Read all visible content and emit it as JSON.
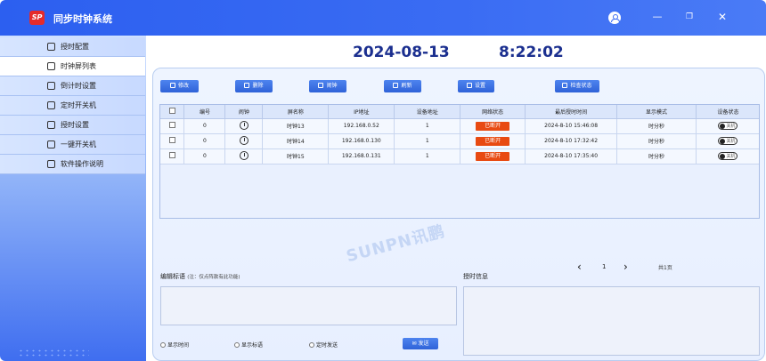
{
  "app": {
    "title": "同步时钟系统",
    "logo_text": "SP"
  },
  "window_controls": [
    "minimize-icon",
    "restore-icon",
    "close-icon"
  ],
  "sidebar": {
    "items": [
      {
        "label": "授时配置",
        "icon": "clock-sync-icon"
      },
      {
        "label": "时钟屏列表",
        "icon": "list-icon",
        "active": true
      },
      {
        "label": "倒计时设置",
        "icon": "hourglass-icon"
      },
      {
        "label": "定时开关机",
        "icon": "power-timer-icon"
      },
      {
        "label": "授时设置",
        "icon": "clock-settings-icon"
      },
      {
        "label": "一键开关机",
        "icon": "power-icon"
      },
      {
        "label": "软件操作说明",
        "icon": "manual-icon"
      }
    ]
  },
  "header": {
    "date": "2024-08-13",
    "time": "8:22:02"
  },
  "toolbar": {
    "edit": "修改",
    "delete": "删除",
    "alarm": "闹钟",
    "refresh": "刷新",
    "settings": "设置",
    "check_status": "检查状态"
  },
  "table": {
    "columns": [
      "",
      "编号",
      "闹钟",
      "屏名称",
      "IP地址",
      "设备地址",
      "网络状态",
      "最后授时时间",
      "显示模式",
      "设备状态"
    ],
    "rows": [
      {
        "id": "0",
        "name": "时钟13",
        "ip": "192.168.0.52",
        "address": "1",
        "net": "已断开",
        "last_sync": "2024-8-10 15:46:08",
        "mode": "时分秒",
        "state": "关机"
      },
      {
        "id": "0",
        "name": "时钟14",
        "ip": "192.168.0.130",
        "address": "1",
        "net": "已断开",
        "last_sync": "2024-8-10 17:32:42",
        "mode": "时分秒",
        "state": "关机"
      },
      {
        "id": "0",
        "name": "时钟15",
        "ip": "192.168.0.131",
        "address": "1",
        "net": "已断开",
        "last_sync": "2024-8-10 17:35:40",
        "mode": "时分秒",
        "state": "关机"
      }
    ]
  },
  "watermark": "SUNPN讯鹏",
  "pager": {
    "page": "1",
    "total": "共1页"
  },
  "edit_title": {
    "label": "编辑标语",
    "note": "(注：仅点阵款有此功能)"
  },
  "sync_info": {
    "label": "授时信息"
  },
  "radios": [
    "显示时间",
    "显示标语",
    "定时发送"
  ],
  "send": "发送",
  "colors": {
    "titlebar": "#3a6cf3",
    "button": "#2f62d8",
    "badge": "#e84a12",
    "date": "#1b2f8f"
  }
}
